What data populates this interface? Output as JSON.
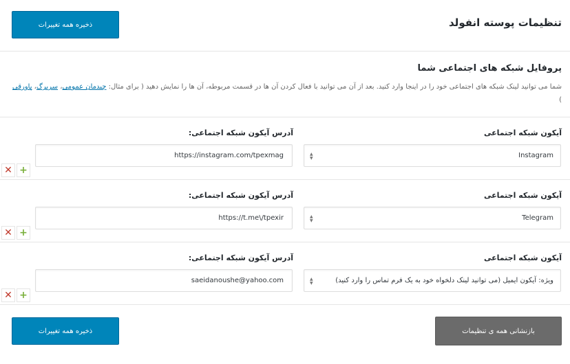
{
  "header": {
    "title": "تنظیمات پوسته انفولد",
    "save_label": "ذخیره همه تغییرات"
  },
  "section": {
    "title": "پروفایل شبکه های اجتماعی شما",
    "desc_text": "شما می توانید لینک شبکه های اجتماعی خود را در اینجا وارد کنید. بعد از آن می توانید با فعال کردن آن ها در قسمت مربوطه، آن ها را نمایش دهید ( برای مثال:",
    "link1": "چیدمان عمومی",
    "link2": "سربرگ",
    "link3": "پاورقی",
    "desc_end": ")"
  },
  "rows": [
    {
      "icon_label": "آیکون شبکه اجتماعی",
      "url_label": "آدرس آیکون شبکه اجتماعی:",
      "icon_value": "Instagram",
      "url_value": "https://instagram.com/tpexmag"
    },
    {
      "icon_label": "آیکون شبکه اجتماعی",
      "url_label": "آدرس آیکون شبکه اجتماعی:",
      "icon_value": "Telegram",
      "url_value": "https://t.me\\/tpexir"
    },
    {
      "icon_label": "آیکون شبکه اجتماعی",
      "url_label": "آدرس آیکون شبکه اجتماعی:",
      "icon_value": "ویژه: آیکون ایمیل (می توانید لینک دلخواه خود به یک فرم تماس را وارد کنید)",
      "url_value": "saeidanoushe@yahoo.com"
    }
  ],
  "controls": {
    "remove_glyph": "✕",
    "add_glyph": "+"
  },
  "footer": {
    "save_label": "ذخیره همه تغییرات",
    "reset_label": "بازنشانی همه ی تنظیمات"
  },
  "colors": {
    "primary": "#0085ba",
    "reset": "#6b6b6b",
    "link": "#0073aa",
    "remove": "#c0392b",
    "add": "#7ab03b"
  }
}
